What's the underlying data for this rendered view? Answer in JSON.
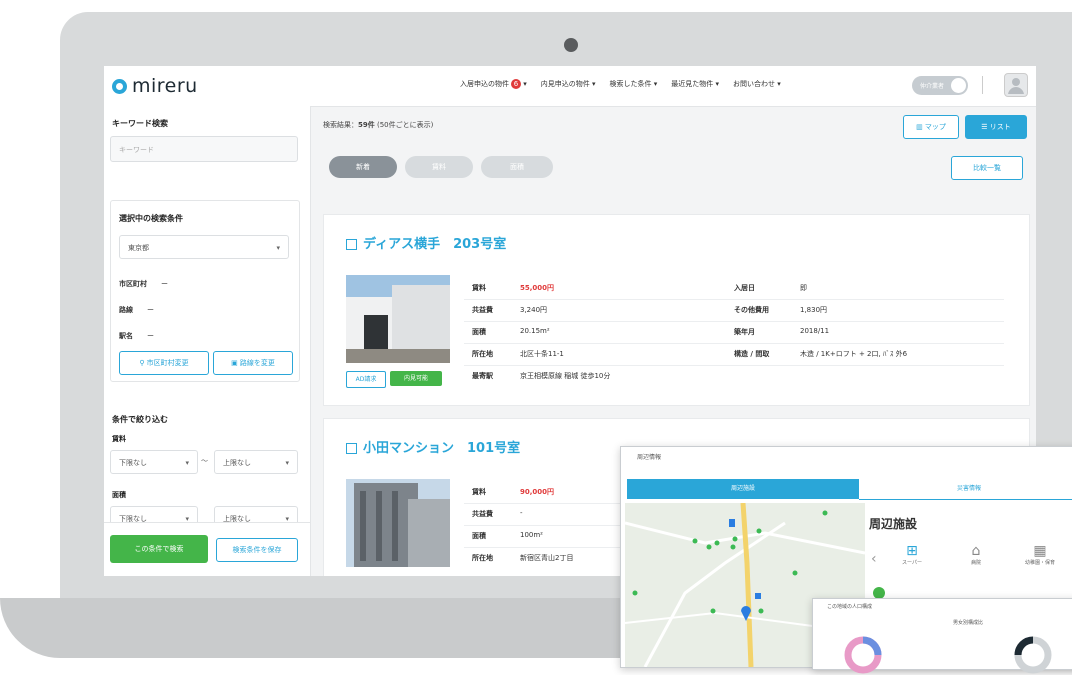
{
  "app": {
    "logo_text": "mireru"
  },
  "header": {
    "nav": [
      "入居申込の物件",
      "内見申込の物件",
      "検索した条件",
      "最近見た物件",
      "お問い合わせ"
    ],
    "nav_badge": "6",
    "toggle_label": "仲介業者"
  },
  "sidebar": {
    "keyword_title": "キーワード検索",
    "keyword_placeholder": "キーワード",
    "selected_title": "選択中の検索条件",
    "prefecture": "東京都",
    "rows": [
      {
        "key": "市区町村",
        "value": "ー"
      },
      {
        "key": "路線",
        "value": "ー"
      },
      {
        "key": "駅名",
        "value": "ー"
      }
    ],
    "change_city_btn": "市区町村変更",
    "change_line_btn": "路線を変更",
    "filter_title": "条件で絞り込む",
    "rent_label": "賃料",
    "rent_min": "下限なし",
    "rent_max": "上限なし",
    "range_sep": "〜",
    "area_label": "面積",
    "area_min": "下限なし",
    "area_max": "上限なし",
    "search_btn": "この条件で検索",
    "save_btn": "検索条件を保存"
  },
  "main": {
    "result_prefix": "検索結果：",
    "result_count": "59件",
    "result_suffix": "(50件ごとに表示)",
    "map_btn": "マップ",
    "list_btn": "リスト",
    "sort_pills": [
      "新着",
      "賃料",
      "面積"
    ],
    "compare_btn": "比較一覧",
    "listings": [
      {
        "title": "ディアス横手　203号室",
        "labels": [
          "賃料",
          "共益費",
          "面積",
          "所在地",
          "最寄駅"
        ],
        "values": [
          "55,000円",
          "3,240円",
          "20.15m²",
          "北区十条11-1",
          "京王相模原線 稲城 徒歩10分"
        ],
        "labels2": [
          "入居日",
          "その他費用",
          "築年月",
          "構造 / 間取"
        ],
        "values2": [
          "即",
          "1,830円",
          "2018/11",
          "木造 / 1K+ロフト + 2口, ﾊﾞｽ 外6"
        ],
        "chip1": "AD請求",
        "chip2": "内見可能"
      },
      {
        "title": "小田マンション　101号室",
        "labels": [
          "賃料",
          "共益費",
          "面積",
          "所在地"
        ],
        "values": [
          "90,000円",
          "-",
          "100m²",
          "新宿区青山2丁目"
        ]
      }
    ]
  },
  "popup": {
    "title": "周辺情報",
    "tabs": [
      "周辺施設",
      "災害情報"
    ],
    "section_title": "周辺施設",
    "facility_labels": [
      "スーパー",
      "病院",
      "幼稚園・保育"
    ]
  },
  "popup2": {
    "title": "この地域の人口構成",
    "subtitle": "男女別構成比"
  },
  "colors": {
    "accent": "#2aa6d8",
    "green": "#44b549",
    "red": "#e03b3b"
  }
}
